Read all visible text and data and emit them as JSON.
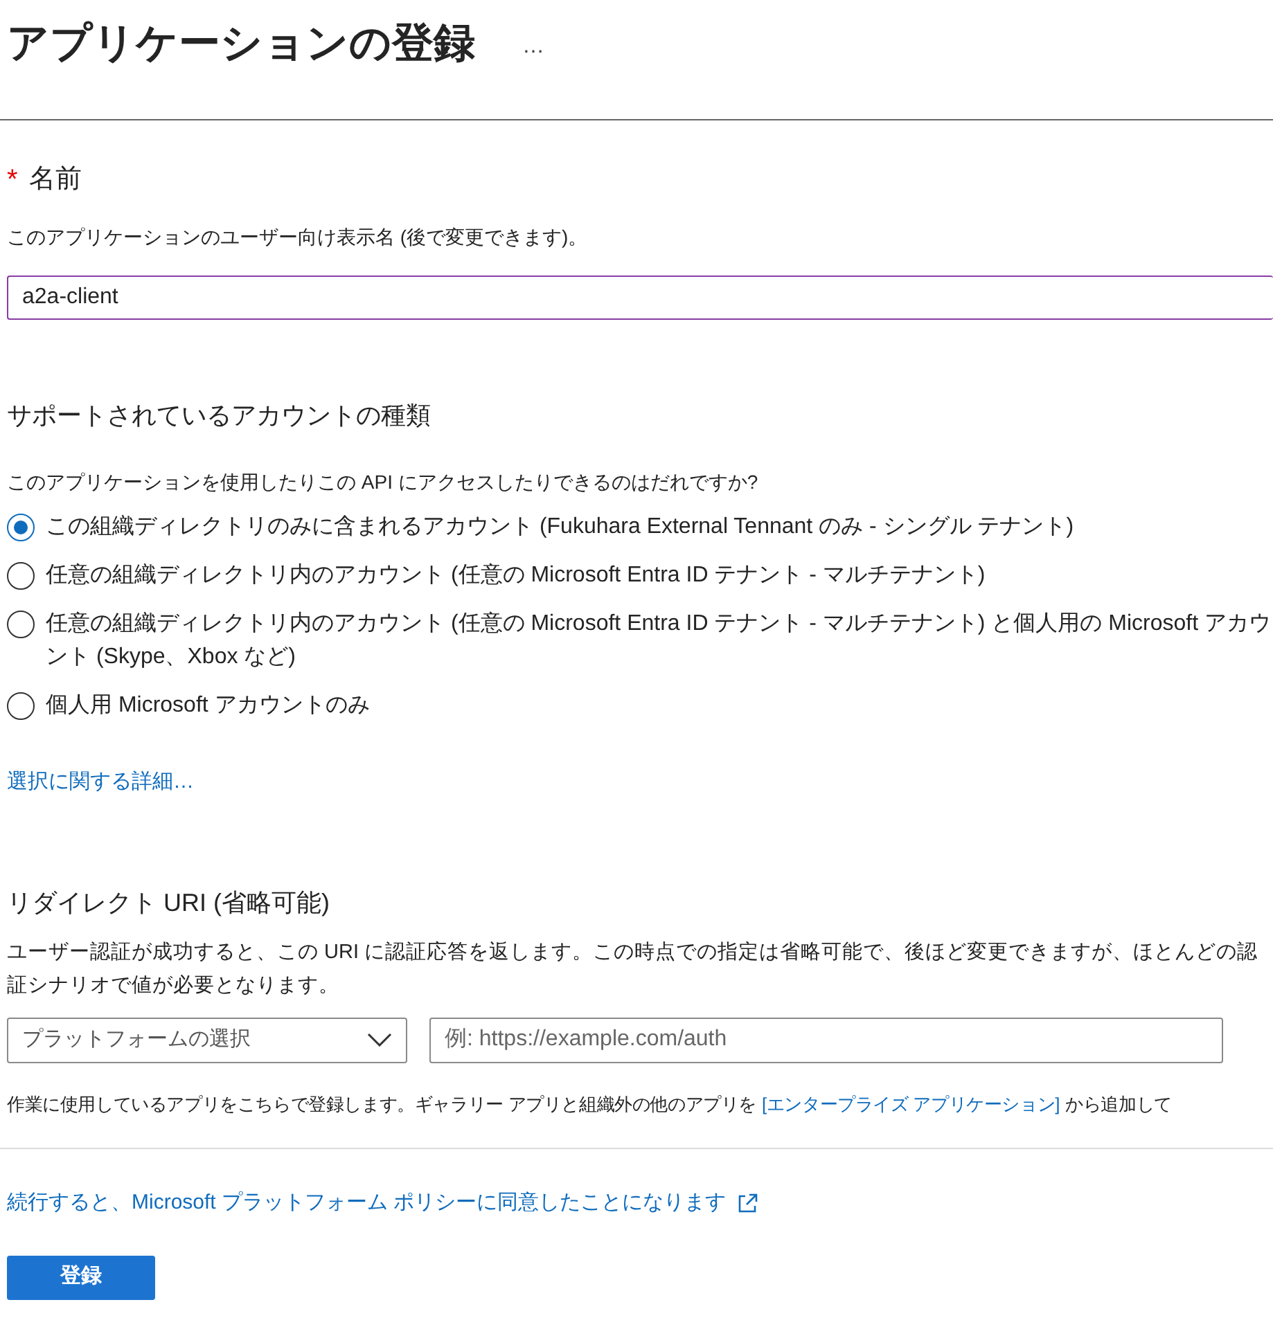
{
  "page": {
    "title": "アプリケーションの登録",
    "more": "…"
  },
  "name_section": {
    "required_mark": "*",
    "label": "名前",
    "description": "このアプリケーションのユーザー向け表示名 (後で変更できます)。",
    "value": "a2a-client"
  },
  "account_types": {
    "heading": "サポートされているアカウントの種類",
    "question": "このアプリケーションを使用したりこの API にアクセスしたりできるのはだれですか?",
    "options": [
      {
        "label": "この組織ディレクトリのみに含まれるアカウント (Fukuhara External Tennant のみ - シングル テナント)",
        "selected": true
      },
      {
        "label": "任意の組織ディレクトリ内のアカウント (任意の Microsoft Entra ID テナント - マルチテナント)",
        "selected": false
      },
      {
        "label": "任意の組織ディレクトリ内のアカウント (任意の Microsoft Entra ID テナント - マルチテナント) と個人用の Microsoft アカウント (Skype、Xbox など)",
        "selected": false
      },
      {
        "label": "個人用 Microsoft アカウントのみ",
        "selected": false
      }
    ],
    "help_link": "選択に関する詳細…"
  },
  "redirect_uri": {
    "heading": "リダイレクト URI (省略可能)",
    "description": "ユーザー認証が成功すると、この URI に認証応答を返します。この時点での指定は省略可能で、後ほど変更できますが、ほとんどの認証シナリオで値が必要となります。",
    "platform_select": "プラットフォームの選択",
    "uri_placeholder": "例: https://example.com/auth"
  },
  "note": {
    "text": "作業に使用しているアプリをこちらで登録します。ギャラリー アプリと組織外の他のアプリを",
    "link": "[エンタープライズ アプリケーション]",
    "text_after": "から追加して"
  },
  "policy_link": "続行すると、Microsoft プラットフォーム ポリシーに同意したことになります",
  "register_button": "登録"
}
